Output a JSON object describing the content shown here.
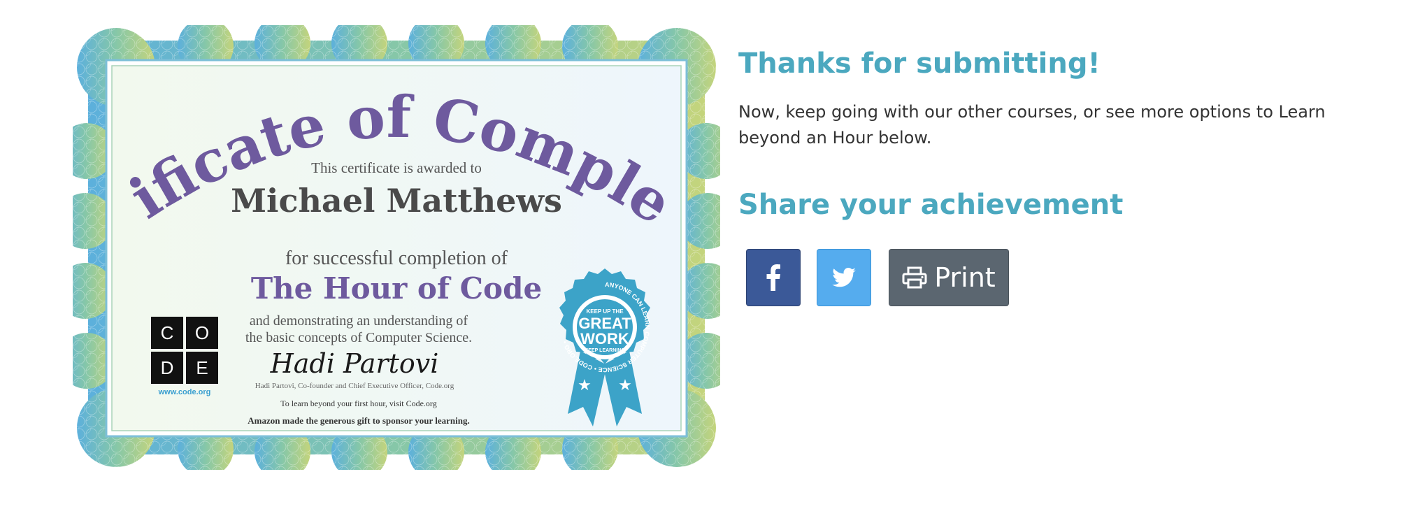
{
  "certificate": {
    "title": "Certificate of Completion",
    "awarded_line": "This certificate is awarded to",
    "recipient": "Michael Matthews",
    "completion_line": "for successful completion of",
    "course": "The Hour of Code",
    "demonstrating_line1": "and demonstrating an understanding of",
    "demonstrating_line2": "the basic concepts of Computer Science.",
    "signature": "Hadi Partovi",
    "signer_caption": "Hadi Partovi, Co-founder and Chief Executive Officer, Code.org",
    "learn_beyond": "To learn beyond your first hour, visit Code.org",
    "sponsor": "Amazon made the generous gift to sponsor your learning.",
    "logo": {
      "letters": [
        "C",
        "O",
        "D",
        "E"
      ],
      "url": "www.code.org"
    },
    "badge": {
      "ring_text": "ANYONE CAN LEARN COMPUTER SCIENCE • CODE.ORG •",
      "top": "KEEP UP THE",
      "line1": "GREAT",
      "line2": "WORK",
      "bottom": "KEEP LEARNING"
    }
  },
  "side": {
    "thanks_heading": "Thanks for submitting!",
    "body": "Now, keep going with our other courses, or see more options to Learn beyond an Hour below.",
    "share_heading": "Share your achievement",
    "share": {
      "facebook_icon": "facebook-icon",
      "twitter_icon": "twitter-icon",
      "print_icon": "printer-icon",
      "print_label": "Print"
    }
  },
  "colors": {
    "heading": "#4ba8bf",
    "facebook": "#3b5998",
    "twitter": "#55acee",
    "print": "#5b6670",
    "certificate_title": "#6e5a9e",
    "badge": "#3ca3c8"
  }
}
